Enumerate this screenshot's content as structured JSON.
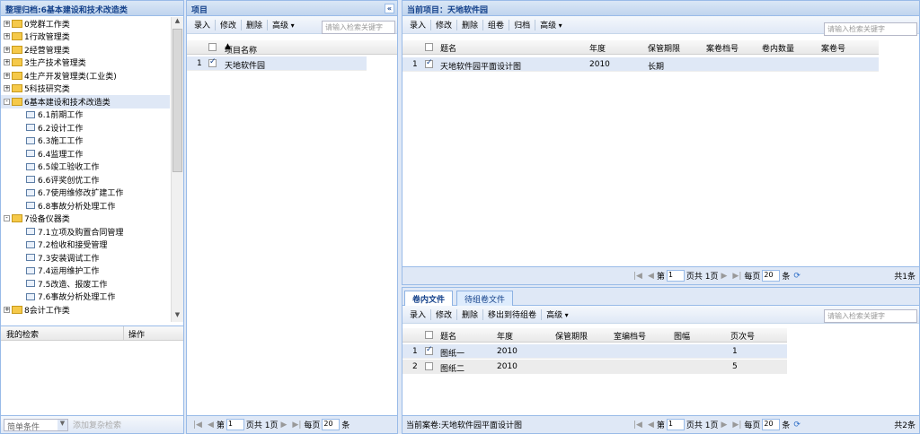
{
  "left": {
    "title": "整理归档:6基本建设和技术改造类",
    "tree": [
      {
        "label": "0党群工作类",
        "level": 0,
        "type": "folder",
        "sign": "+"
      },
      {
        "label": "1行政管理类",
        "level": 0,
        "type": "folder",
        "sign": "+"
      },
      {
        "label": "2经营管理类",
        "level": 0,
        "type": "folder",
        "sign": "+"
      },
      {
        "label": "3生产技术管理类",
        "level": 0,
        "type": "folder",
        "sign": "+"
      },
      {
        "label": "4生产开发管理类(工业类)",
        "level": 0,
        "type": "folder",
        "sign": "+"
      },
      {
        "label": "5科技研究类",
        "level": 0,
        "type": "folder",
        "sign": "+"
      },
      {
        "label": "6基本建设和技术改造类",
        "level": 0,
        "type": "folder",
        "sign": "-",
        "selected": true
      },
      {
        "label": "6.1前期工作",
        "level": 1,
        "type": "doc"
      },
      {
        "label": "6.2设计工作",
        "level": 1,
        "type": "doc"
      },
      {
        "label": "6.3施工工作",
        "level": 1,
        "type": "doc"
      },
      {
        "label": "6.4监理工作",
        "level": 1,
        "type": "doc"
      },
      {
        "label": "6.5竣工验收工作",
        "level": 1,
        "type": "doc"
      },
      {
        "label": "6.6评奖创优工作",
        "level": 1,
        "type": "doc"
      },
      {
        "label": "6.7使用维修改扩建工作",
        "level": 1,
        "type": "doc"
      },
      {
        "label": "6.8事故分析处理工作",
        "level": 1,
        "type": "doc"
      },
      {
        "label": "7设备仪器类",
        "level": 0,
        "type": "folder",
        "sign": "-"
      },
      {
        "label": "7.1立项及购置合同管理",
        "level": 1,
        "type": "doc"
      },
      {
        "label": "7.2检收和接受管理",
        "level": 1,
        "type": "doc"
      },
      {
        "label": "7.3安装调试工作",
        "level": 1,
        "type": "doc"
      },
      {
        "label": "7.4运用维护工作",
        "level": 1,
        "type": "doc"
      },
      {
        "label": "7.5改造、报废工作",
        "level": 1,
        "type": "doc"
      },
      {
        "label": "7.6事故分析处理工作",
        "level": 1,
        "type": "doc"
      },
      {
        "label": "8会计工作类",
        "level": 0,
        "type": "folder",
        "sign": "+"
      }
    ],
    "search_cols": [
      "我的检索",
      "操作"
    ],
    "filter_value": "简单条件",
    "filter_btn": "添加复杂检索"
  },
  "project": {
    "title": "项目",
    "toolbar": [
      "录入",
      "修改",
      "删除",
      "高级"
    ],
    "search_placeholder": "请输入检索关键字",
    "col_name": "项目名称",
    "rows": [
      {
        "num": "1",
        "name": "天地软件园",
        "checked": true
      }
    ],
    "pager": {
      "page_label": "第",
      "page": "1",
      "of": "页共 1页",
      "per_label": "每页",
      "per": "20",
      "unit": "条"
    }
  },
  "top": {
    "title": "当前项目：天地软件园",
    "toolbar": [
      "录入",
      "修改",
      "删除",
      "组卷",
      "归档",
      "高级"
    ],
    "search_placeholder": "请输入检索关键字",
    "cols": [
      "题名",
      "年度",
      "保管期限",
      "案卷档号",
      "卷内数量",
      "案卷号"
    ],
    "rows": [
      {
        "num": "1",
        "title": "天地软件园平面设计图",
        "year": "2010",
        "period": "长期",
        "checked": true
      }
    ],
    "pager": {
      "page_label": "第",
      "page": "1",
      "of": "页共 1页",
      "per_label": "每页",
      "per": "20",
      "unit": "条",
      "total": "共1条"
    }
  },
  "bottom": {
    "tabs": [
      "卷内文件",
      "待组卷文件"
    ],
    "toolbar": [
      "录入",
      "修改",
      "删除",
      "移出到待组卷",
      "高级"
    ],
    "search_placeholder": "请输入检索关键字",
    "cols": [
      "题名",
      "年度",
      "保管期限",
      "室编档号",
      "图幅",
      "页次号"
    ],
    "rows": [
      {
        "num": "1",
        "title": "图纸一",
        "year": "2010",
        "page": "1",
        "checked": true
      },
      {
        "num": "2",
        "title": "图纸二",
        "year": "2010",
        "page": "5",
        "checked": false
      }
    ],
    "status": "当前案卷:天地软件园平面设计图",
    "pager": {
      "page_label": "第",
      "page": "1",
      "of": "页共 1页",
      "per_label": "每页",
      "per": "20",
      "unit": "条",
      "total": "共2条"
    }
  }
}
